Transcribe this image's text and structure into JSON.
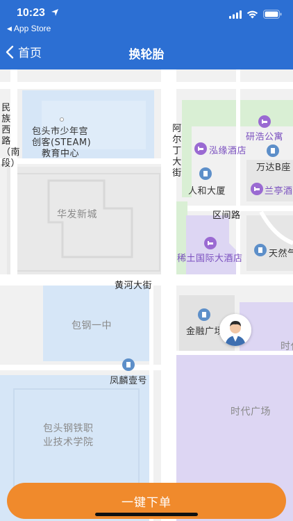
{
  "status_bar": {
    "time": "10:23",
    "back_app": "App Store"
  },
  "nav": {
    "back_label": "首页",
    "title": "换轮胎"
  },
  "map": {
    "roads": {
      "minzu_west": "民族西路（南段）",
      "aerding": "阿尔丁大街",
      "huanghe": "黄河大街",
      "qujian": "区间路"
    },
    "areas": {
      "huafa": "华发新城",
      "baogang_yizhong": "包钢一中",
      "times_square": "时代广场",
      "times_edge": "时代"
    },
    "pois": {
      "youth_palace_line1": "包头市少年宫",
      "youth_palace_line2": "创客(STEAM)",
      "youth_palace_line3": "教育中心",
      "yanhao": "研浩公寓",
      "hongyuan": "泓缘酒店",
      "wanda": "万达B座",
      "renhe": "人和大厦",
      "lanting": "兰亭酒",
      "xitu": "稀土国际大酒店",
      "tianran": "天然气",
      "jinrong": "金融广场",
      "fenglin": "凤麟壹号",
      "college_line1": "包头钢铁职",
      "college_line2": "业技术学院"
    }
  },
  "actions": {
    "order_button": "一键下单"
  },
  "colors": {
    "header": "#2c6fd3",
    "button": "#f08a2c",
    "map_bg": "#f3f3f3",
    "water": "#d6e6f7",
    "park": "#d9efd4",
    "purple_area": "#ddd6f3"
  }
}
